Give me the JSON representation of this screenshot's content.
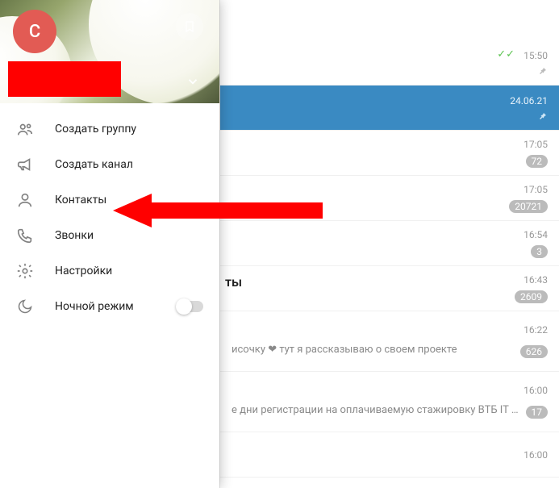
{
  "drawer": {
    "avatar_letter": "C",
    "items": [
      {
        "label": "Создать группу"
      },
      {
        "label": "Создать канал"
      },
      {
        "label": "Контакты"
      },
      {
        "label": "Звонки"
      },
      {
        "label": "Настройки"
      },
      {
        "label": "Ночной режим"
      }
    ]
  },
  "chats": {
    "row0": {
      "time": "15:50"
    },
    "row1": {
      "time": "24.06.21"
    },
    "row2": {
      "time": "17:05",
      "badge": "72"
    },
    "row3": {
      "time": "17:05",
      "badge": "20721"
    },
    "row4": {
      "time": "16:54",
      "badge": "3"
    },
    "row5": {
      "time": "16:43",
      "badge": "2609",
      "title_fragment": "ты"
    },
    "row6": {
      "time": "16:22",
      "badge": "626",
      "snippet": "исочку ❤ тут я рассказываю о своем проекте"
    },
    "row7": {
      "time": "16:00",
      "badge": "17",
      "snippet": "е дни регистрации на оплачиваемую стажировку ВТБ IT Ю…"
    },
    "row8": {
      "time": "16:00"
    }
  }
}
